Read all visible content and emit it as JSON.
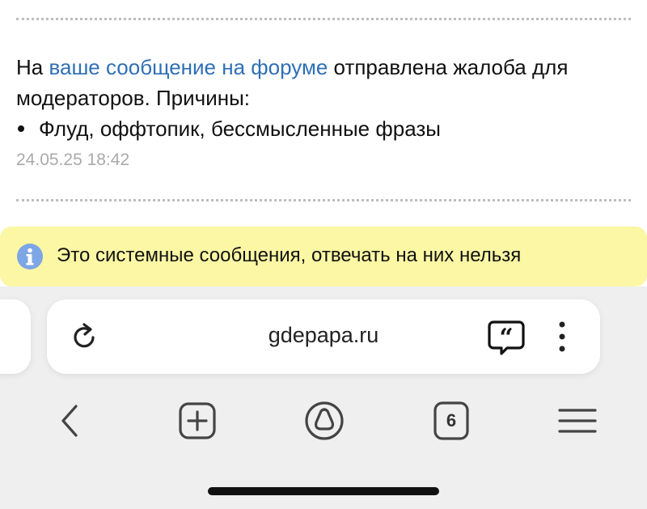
{
  "notification": {
    "prefix": "На ",
    "link_text": "ваше сообщение на форуме",
    "suffix": " отправлена жалоба для модераторов. Причины:",
    "reasons": [
      "Флуд, оффтопик, бессмысленные фразы"
    ],
    "timestamp": "24.05.25 18:42"
  },
  "system_notice": {
    "icon": "info-icon",
    "text": "Это системные сообщения, отвечать на них нельзя"
  },
  "browser": {
    "address_bar": {
      "url": "gdepapa.ru",
      "left_icon": "reload-icon",
      "right_icons": [
        "quote-bubble-icon",
        "more-vertical-icon"
      ]
    },
    "bottom_nav": {
      "items": [
        "back-icon",
        "new-tab-icon",
        "alice-icon",
        "tabs-button",
        "menu-icon"
      ],
      "tabs_count": "6"
    }
  },
  "colors": {
    "link": "#2f6fb5",
    "notice_bg": "#fbf7a4",
    "info_icon": "#7da6e6",
    "toolbar_bg": "#efefef",
    "timestamp": "#aaaaaa"
  }
}
